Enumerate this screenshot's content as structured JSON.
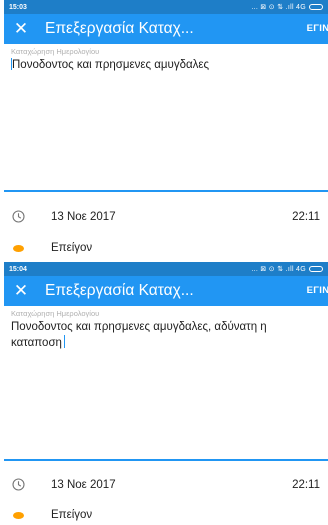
{
  "frames": [
    {
      "status_time": "15:03",
      "status_icons": "... ⊠ ⊙ ⇅ .ıll 4G",
      "title": "Επεξεργασία Καταχ...",
      "action": "ΕΓΙΝΕ",
      "field_label": "Καταχώρηση Ημερολογίου",
      "entry_text": "Πονοδοντος και πρησμενες αμυγδαλες",
      "date": "13 Νοε 2017",
      "time": "22:11",
      "priority": "Επείγον"
    },
    {
      "status_time": "15:04",
      "status_icons": "... ⊠ ⊙ ⇅ .ıll 4G",
      "title": "Επεξεργασία Καταχ...",
      "action": "ΕΓΙΝΕ",
      "field_label": "Καταχώρηση Ημερολογίου",
      "entry_text": "Πονοδοντος και πρησμενες αμυγδαλες, αδύνατη η καταποση",
      "date": "13 Νοε 2017",
      "time": "22:11",
      "priority": "Επείγον"
    }
  ],
  "icons": {
    "close": "close-icon",
    "clock": "clock-icon",
    "priority": "priority-dot-icon",
    "battery": "battery-icon"
  },
  "colors": {
    "appbar": "#2196F3",
    "statusbar": "#1E7EC8",
    "priority": "#FFA000",
    "accent": "#2196F3"
  }
}
